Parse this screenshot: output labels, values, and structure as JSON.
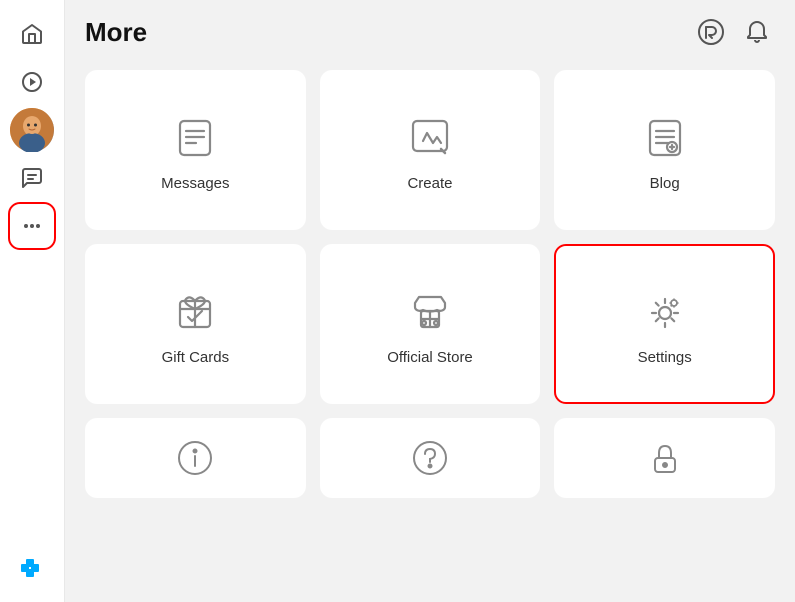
{
  "header": {
    "title": "More"
  },
  "sidebar": {
    "items": [
      {
        "id": "home",
        "label": "Home",
        "icon": "home"
      },
      {
        "id": "discover",
        "label": "Discover",
        "icon": "play"
      },
      {
        "id": "avatar",
        "label": "Avatar",
        "icon": "avatar"
      },
      {
        "id": "chat",
        "label": "Chat",
        "icon": "chat"
      },
      {
        "id": "more",
        "label": "More",
        "icon": "more",
        "active": true
      }
    ]
  },
  "cards": [
    {
      "id": "messages",
      "label": "Messages",
      "icon": "messages",
      "highlighted": false
    },
    {
      "id": "create",
      "label": "Create",
      "icon": "create",
      "highlighted": false
    },
    {
      "id": "blog",
      "label": "Blog",
      "icon": "blog",
      "highlighted": false
    },
    {
      "id": "gift-cards",
      "label": "Gift Cards",
      "icon": "gift-cards",
      "highlighted": false
    },
    {
      "id": "official-store",
      "label": "Official Store",
      "icon": "official-store",
      "highlighted": false
    },
    {
      "id": "settings",
      "label": "Settings",
      "icon": "settings",
      "highlighted": true
    },
    {
      "id": "info",
      "label": "",
      "icon": "info",
      "highlighted": false,
      "partial": true
    },
    {
      "id": "help",
      "label": "",
      "icon": "help",
      "highlighted": false,
      "partial": true
    },
    {
      "id": "lock",
      "label": "",
      "icon": "lock",
      "highlighted": false,
      "partial": true
    }
  ]
}
